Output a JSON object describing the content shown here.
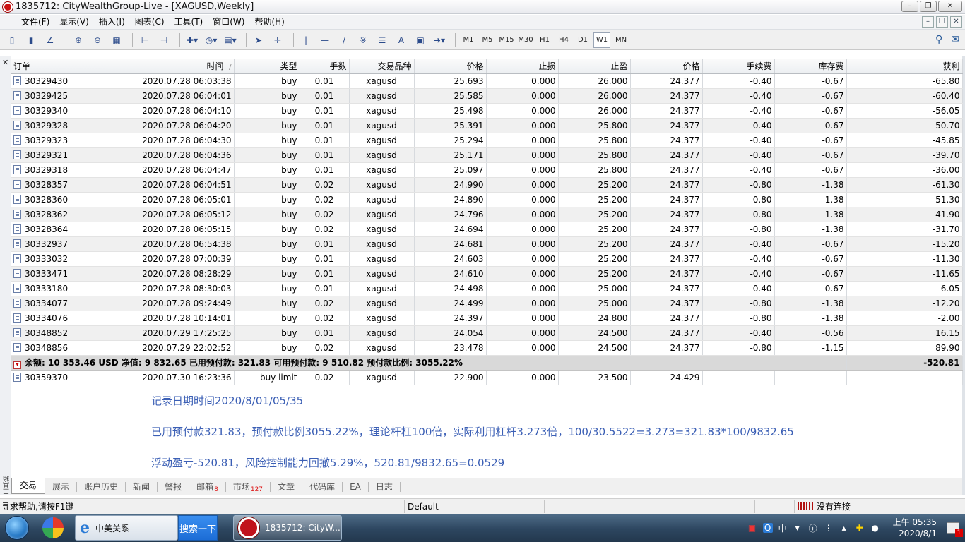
{
  "window": {
    "title": "1835712: CityWealthGroup-Live - [XAGUSD,Weekly]"
  },
  "menu": [
    "文件(F)",
    "显示(V)",
    "插入(I)",
    "图表(C)",
    "工具(T)",
    "窗口(W)",
    "帮助(H)"
  ],
  "toolbar": {
    "timeframes": [
      "M1",
      "M5",
      "M15",
      "M30",
      "H1",
      "H4",
      "D1",
      "W1",
      "MN"
    ],
    "active_timeframe": "W1"
  },
  "table": {
    "columns": [
      "订单",
      "时间",
      "/",
      "类型",
      "手数",
      "交易品种",
      "价格",
      "止损",
      "止盈",
      "价格",
      "手续费",
      "库存费",
      "获利"
    ],
    "rows": [
      [
        "30329430",
        "2020.07.28 06:03:38",
        "buy",
        "0.01",
        "xagusd",
        "25.693",
        "0.000",
        "26.000",
        "24.377",
        "-0.40",
        "-0.67",
        "-65.80"
      ],
      [
        "30329425",
        "2020.07.28 06:04:01",
        "buy",
        "0.01",
        "xagusd",
        "25.585",
        "0.000",
        "26.000",
        "24.377",
        "-0.40",
        "-0.67",
        "-60.40"
      ],
      [
        "30329340",
        "2020.07.28 06:04:10",
        "buy",
        "0.01",
        "xagusd",
        "25.498",
        "0.000",
        "26.000",
        "24.377",
        "-0.40",
        "-0.67",
        "-56.05"
      ],
      [
        "30329328",
        "2020.07.28 06:04:20",
        "buy",
        "0.01",
        "xagusd",
        "25.391",
        "0.000",
        "25.800",
        "24.377",
        "-0.40",
        "-0.67",
        "-50.70"
      ],
      [
        "30329323",
        "2020.07.28 06:04:30",
        "buy",
        "0.01",
        "xagusd",
        "25.294",
        "0.000",
        "25.800",
        "24.377",
        "-0.40",
        "-0.67",
        "-45.85"
      ],
      [
        "30329321",
        "2020.07.28 06:04:36",
        "buy",
        "0.01",
        "xagusd",
        "25.171",
        "0.000",
        "25.800",
        "24.377",
        "-0.40",
        "-0.67",
        "-39.70"
      ],
      [
        "30329318",
        "2020.07.28 06:04:47",
        "buy",
        "0.01",
        "xagusd",
        "25.097",
        "0.000",
        "25.800",
        "24.377",
        "-0.40",
        "-0.67",
        "-36.00"
      ],
      [
        "30328357",
        "2020.07.28 06:04:51",
        "buy",
        "0.02",
        "xagusd",
        "24.990",
        "0.000",
        "25.200",
        "24.377",
        "-0.80",
        "-1.38",
        "-61.30"
      ],
      [
        "30328360",
        "2020.07.28 06:05:01",
        "buy",
        "0.02",
        "xagusd",
        "24.890",
        "0.000",
        "25.200",
        "24.377",
        "-0.80",
        "-1.38",
        "-51.30"
      ],
      [
        "30328362",
        "2020.07.28 06:05:12",
        "buy",
        "0.02",
        "xagusd",
        "24.796",
        "0.000",
        "25.200",
        "24.377",
        "-0.80",
        "-1.38",
        "-41.90"
      ],
      [
        "30328364",
        "2020.07.28 06:05:15",
        "buy",
        "0.02",
        "xagusd",
        "24.694",
        "0.000",
        "25.200",
        "24.377",
        "-0.80",
        "-1.38",
        "-31.70"
      ],
      [
        "30332937",
        "2020.07.28 06:54:38",
        "buy",
        "0.01",
        "xagusd",
        "24.681",
        "0.000",
        "25.200",
        "24.377",
        "-0.40",
        "-0.67",
        "-15.20"
      ],
      [
        "30333032",
        "2020.07.28 07:00:39",
        "buy",
        "0.01",
        "xagusd",
        "24.603",
        "0.000",
        "25.200",
        "24.377",
        "-0.40",
        "-0.67",
        "-11.30"
      ],
      [
        "30333471",
        "2020.07.28 08:28:29",
        "buy",
        "0.01",
        "xagusd",
        "24.610",
        "0.000",
        "25.200",
        "24.377",
        "-0.40",
        "-0.67",
        "-11.65"
      ],
      [
        "30333180",
        "2020.07.28 08:30:03",
        "buy",
        "0.01",
        "xagusd",
        "24.498",
        "0.000",
        "25.000",
        "24.377",
        "-0.40",
        "-0.67",
        "-6.05"
      ],
      [
        "30334077",
        "2020.07.28 09:24:49",
        "buy",
        "0.02",
        "xagusd",
        "24.499",
        "0.000",
        "25.000",
        "24.377",
        "-0.80",
        "-1.38",
        "-12.20"
      ],
      [
        "30334076",
        "2020.07.28 10:14:01",
        "buy",
        "0.02",
        "xagusd",
        "24.397",
        "0.000",
        "24.800",
        "24.377",
        "-0.80",
        "-1.38",
        "-2.00"
      ],
      [
        "30348852",
        "2020.07.29 17:25:25",
        "buy",
        "0.01",
        "xagusd",
        "24.054",
        "0.000",
        "24.500",
        "24.377",
        "-0.40",
        "-0.56",
        "16.15"
      ],
      [
        "30348856",
        "2020.07.29 22:02:52",
        "buy",
        "0.02",
        "xagusd",
        "23.478",
        "0.000",
        "24.500",
        "24.377",
        "-0.80",
        "-1.15",
        "89.90"
      ]
    ],
    "summary": {
      "text": "余额: 10 353.46 USD  净值: 9 832.65  已用预付款: 321.83  可用预付款: 9 510.82  预付款比例: 3055.22%",
      "profit": "-520.81"
    },
    "pending": [
      "30359370",
      "2020.07.30 16:23:36",
      "buy limit",
      "0.02",
      "xagusd",
      "22.900",
      "0.000",
      "23.500",
      "24.429"
    ]
  },
  "annotations": [
    "记录日期时间2020/8/01/05/35",
    "已用预付款321.83，预付款比例3055.22%，理论杆杠100倍，实际利用杠杆3.273倍，100/30.5522=3.273=321.83*100/9832.65",
    "浮动盈亏-520.81，风险控制能力回撤5.29%，520.81/9832.65=0.0529"
  ],
  "tabs": [
    {
      "label": "交易"
    },
    {
      "label": "展示"
    },
    {
      "label": "账户历史"
    },
    {
      "label": "新闻"
    },
    {
      "label": "警报"
    },
    {
      "label": "邮箱",
      "badge": "8"
    },
    {
      "label": "市场",
      "badge": "127"
    },
    {
      "label": "文章"
    },
    {
      "label": "代码库"
    },
    {
      "label": "EA"
    },
    {
      "label": "日志"
    }
  ],
  "side_label": "工具箱",
  "status": {
    "help": "寻求帮助,请按F1键",
    "profile": "Default",
    "connection": "没有连接"
  },
  "taskbar": {
    "ie_label": "中美关系",
    "search_label": "搜索一下",
    "mt4_label": "1835712: CityW...",
    "lang": "中",
    "clock_time": "上午 05:35",
    "clock_date": "2020/8/1",
    "notif_count": "1"
  },
  "colors": {
    "annotation": "#3b5fb5",
    "summary_bg": "#d9d9d9",
    "badge": "#dd1111"
  }
}
